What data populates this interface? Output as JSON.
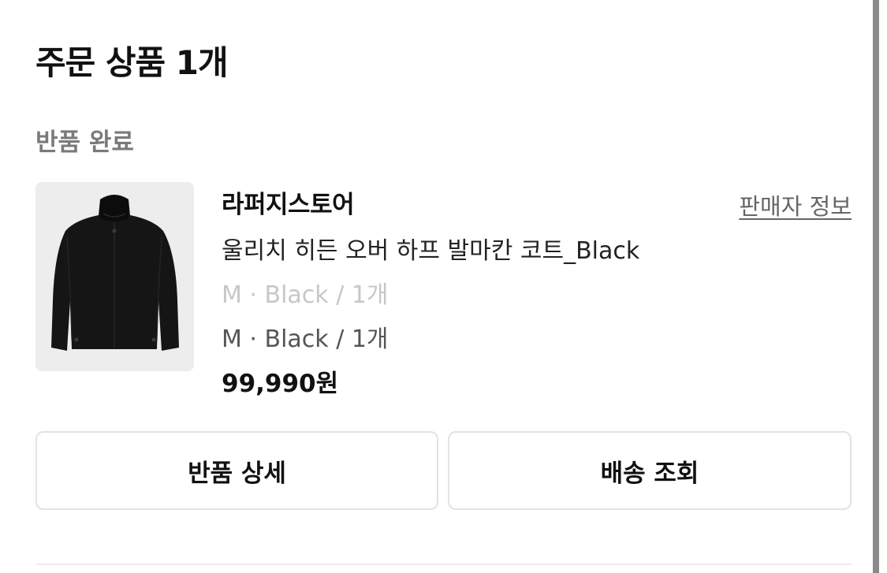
{
  "section": {
    "title": "주문 상품 1개"
  },
  "order_item": {
    "status": "반품 완료",
    "store_name": "라퍼지스토어",
    "seller_info_link": "판매자 정보",
    "product_name": "울리치 히든 오버 하프 발마칸 코트_Black",
    "original_option": "M · Black / 1개",
    "option": "M · Black / 1개",
    "price": "99,990원",
    "thumbnail_icon": "black-coat-product-image"
  },
  "actions": {
    "return_detail_label": "반품 상세",
    "track_shipping_label": "배송 조회"
  }
}
